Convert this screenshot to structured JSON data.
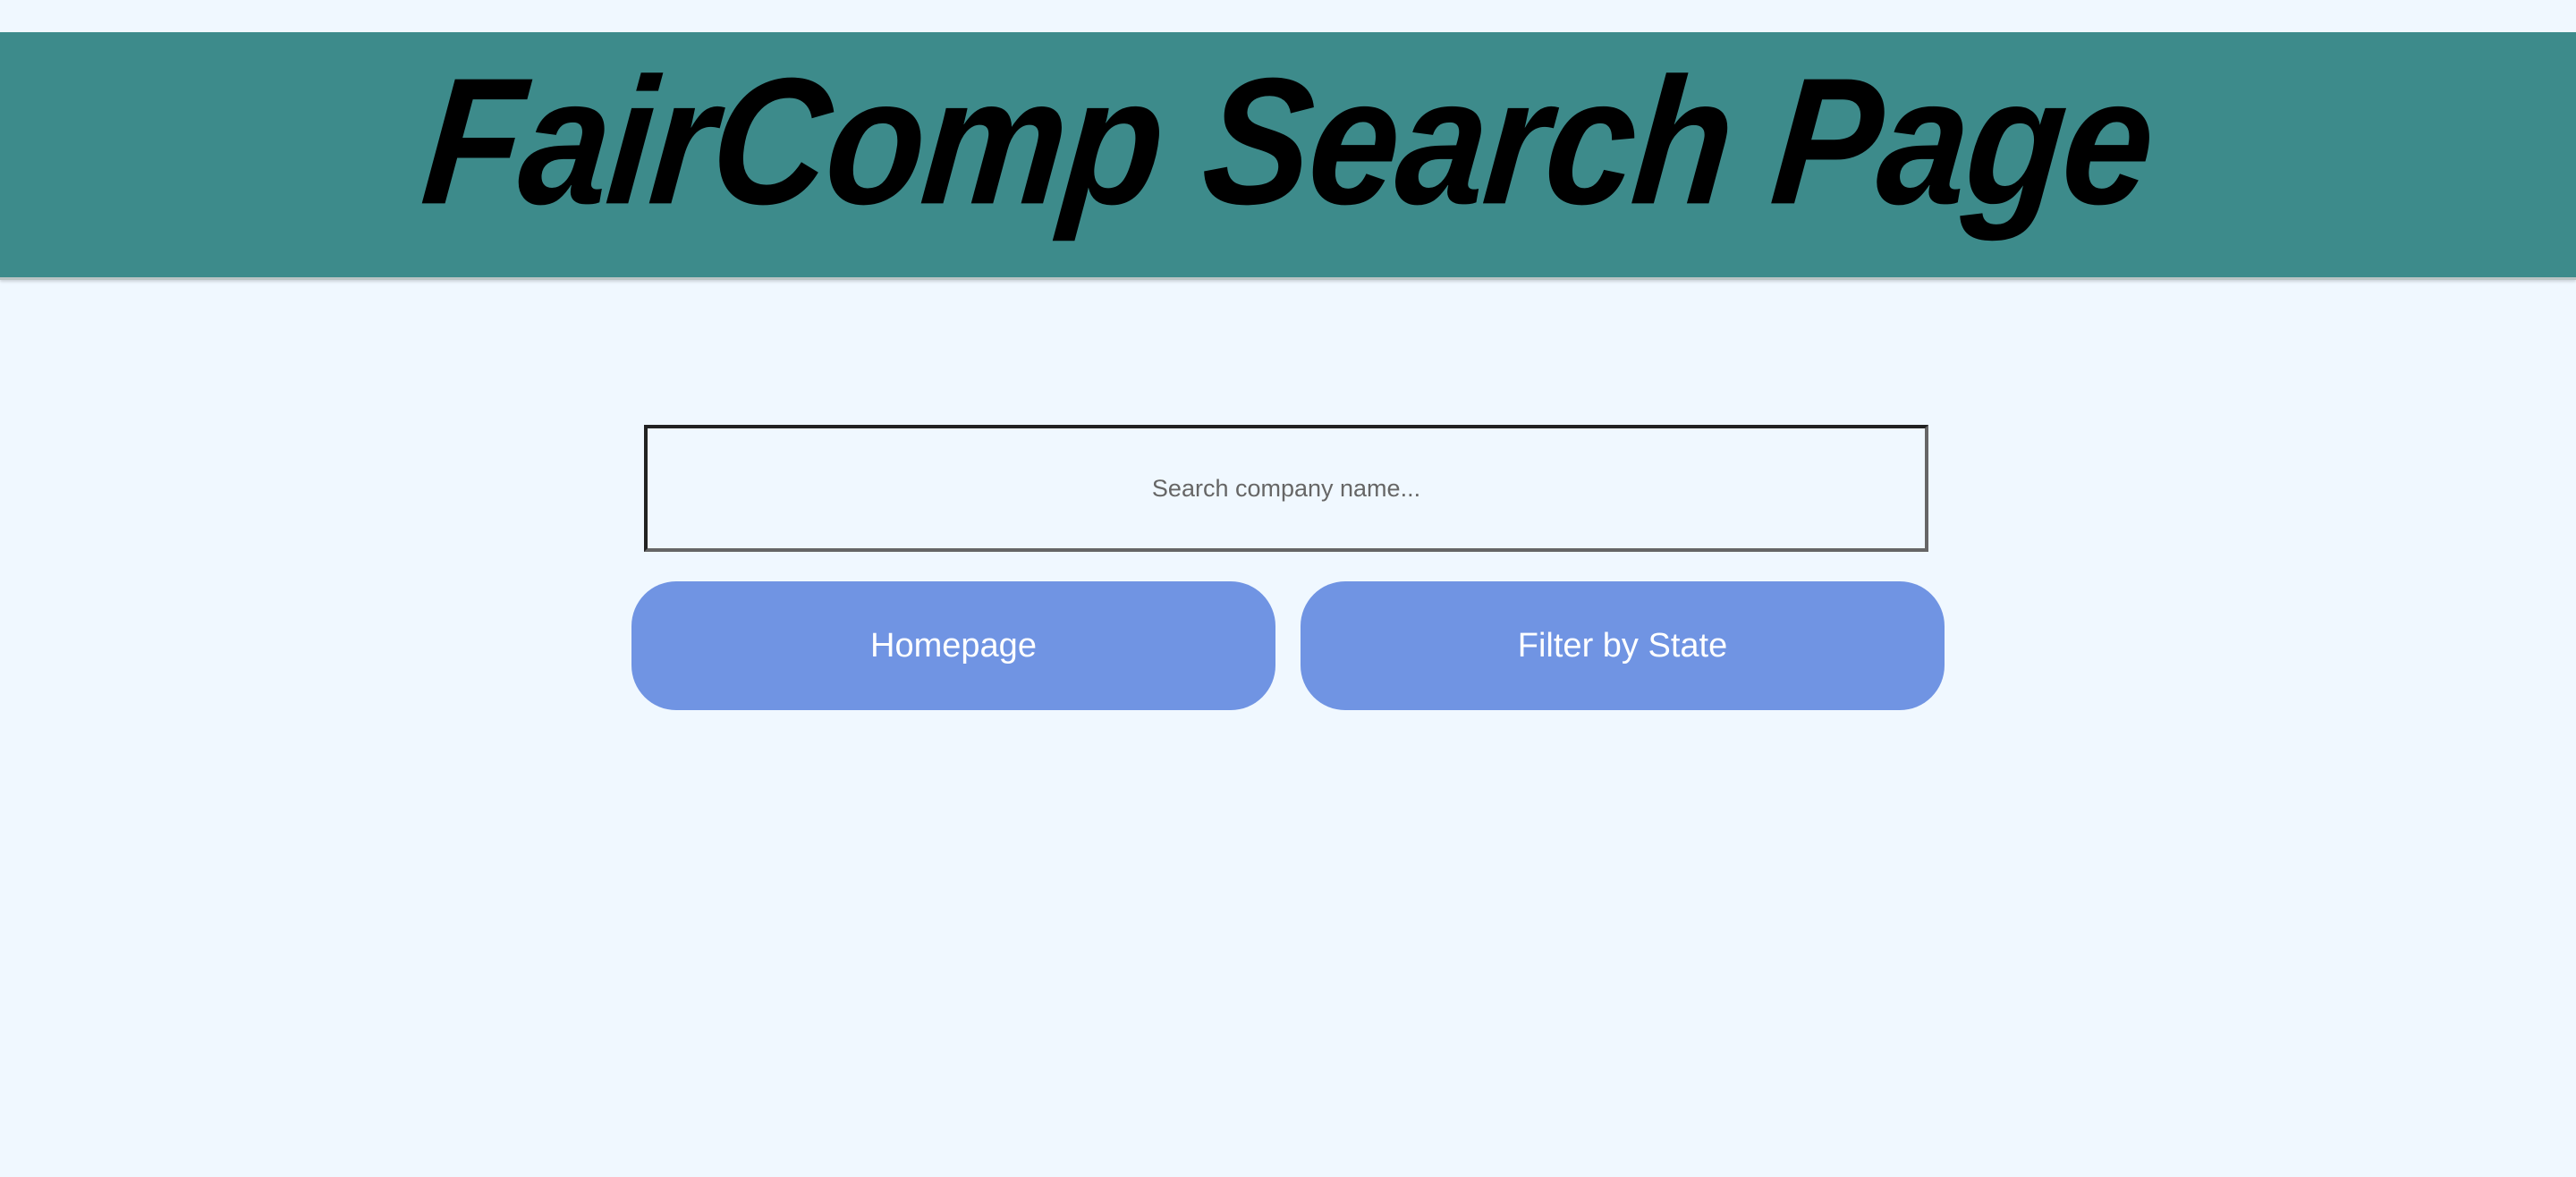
{
  "header": {
    "title": "FairComp Search Page"
  },
  "search": {
    "placeholder": "Search company name...",
    "value": ""
  },
  "buttons": {
    "homepage_label": "Homepage",
    "filter_label": "Filter by State"
  },
  "colors": {
    "page_background": "#f0f8ff",
    "header_background": "#3d8b8b",
    "button_background": "#7094e3",
    "button_text": "#ffffff"
  }
}
